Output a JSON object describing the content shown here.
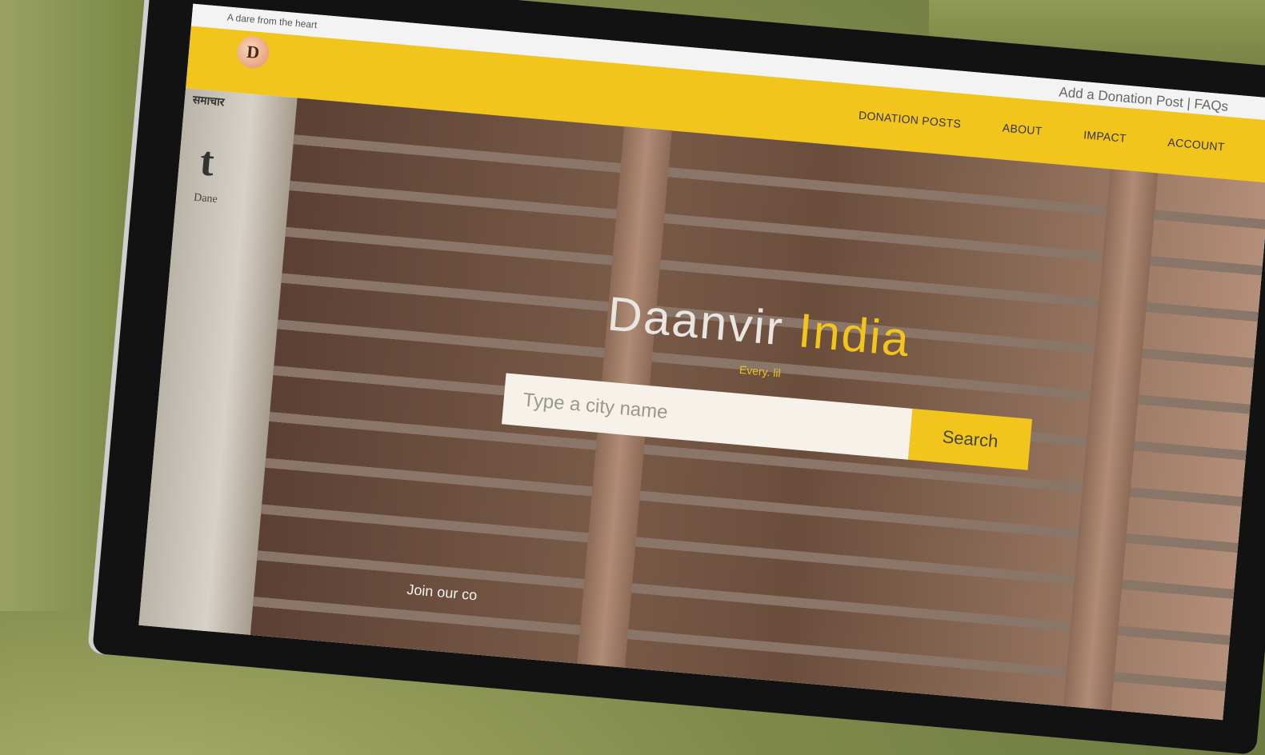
{
  "app": {
    "tagline": "A dare from the heart",
    "logo_letter": "D"
  },
  "header": {
    "utility_link": "Add a Donation Post | FAQs",
    "nav": [
      {
        "label": "DONATION POSTS"
      },
      {
        "label": "ABOUT"
      },
      {
        "label": "IMPACT"
      },
      {
        "label": "ACCOUNT"
      }
    ]
  },
  "sidebar": {
    "top_text": "समाचार",
    "big_letter": "t",
    "small_text": "Dane"
  },
  "hero": {
    "title_part1": "Daanvir",
    "title_part2": "India",
    "subtitle": "Every. lil",
    "search_placeholder": "Type a city name",
    "search_button": "Search",
    "footer_text": "Join our co"
  },
  "colors": {
    "brand_yellow": "#f2c51c",
    "hero_title_white": "#e9e5e0"
  },
  "icons": {
    "logo": "daanvir-logo-icon"
  }
}
